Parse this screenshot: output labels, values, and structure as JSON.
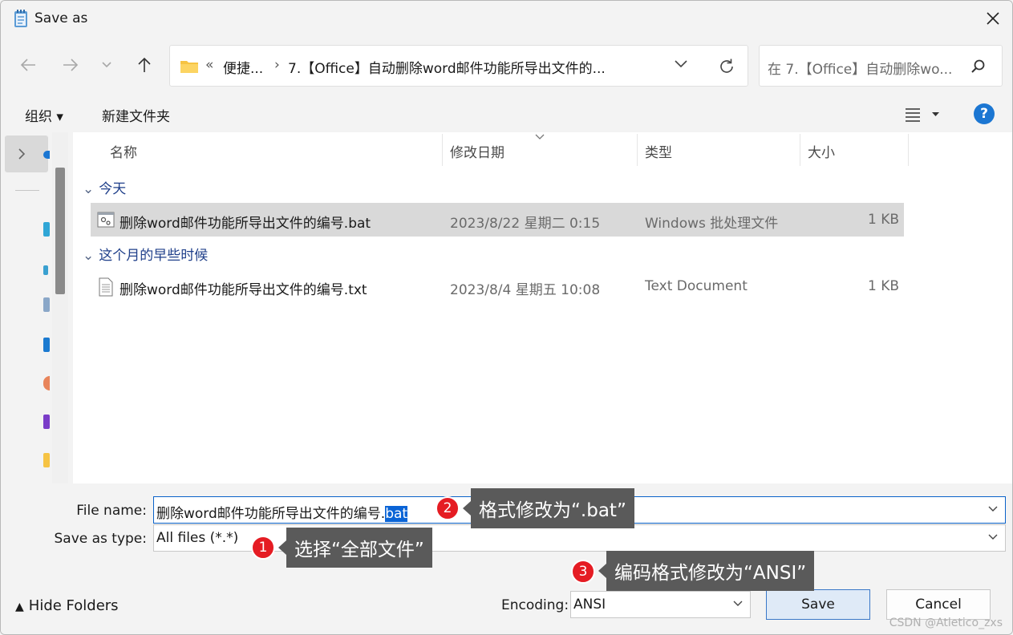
{
  "window": {
    "title": "Save as"
  },
  "address": {
    "overflow": "«",
    "crumb1": "便捷...",
    "separator": "›",
    "crumb2": "7.【Office】自动删除word邮件功能所导出文件的..."
  },
  "search": {
    "placeholder": "在 7.【Office】自动删除wo..."
  },
  "toolbar": {
    "organize": "组织 ▾",
    "new_folder": "新建文件夹"
  },
  "columns": {
    "name": "名称",
    "date": "修改日期",
    "type": "类型",
    "size": "大小"
  },
  "groups": [
    {
      "label": "今天",
      "files": [
        {
          "name": "删除word邮件功能所导出文件的编号.bat",
          "date": "2023/8/22 星期二 0:15",
          "type": "Windows 批处理文件",
          "size": "1 KB"
        }
      ]
    },
    {
      "label": "这个月的早些时候",
      "files": [
        {
          "name": "删除word邮件功能所导出文件的编号.txt",
          "date": "2023/8/4 星期五 10:08",
          "type": "Text Document",
          "size": "1 KB"
        }
      ]
    }
  ],
  "form": {
    "file_name_label": "File name:",
    "file_name_value": "删除word邮件功能所导出文件的编号.",
    "file_name_selected": "bat",
    "save_type_label": "Save as type:",
    "save_type_value": "All files  (*.*)",
    "encoding_label": "Encoding:",
    "encoding_value": "ANSI",
    "save_label": "Save",
    "cancel_label": "Cancel",
    "hide_folders_label": "Hide Folders"
  },
  "annotations": [
    {
      "number": "1",
      "text": "选择“全部文件”"
    },
    {
      "number": "2",
      "text": "格式修改为“.bat”"
    },
    {
      "number": "3",
      "text": "编码格式修改为“ANSI”"
    }
  ],
  "watermark": "CSDN @Atletico_zxs",
  "colors": {
    "accent": "#0a64d6",
    "help": "#1b76d2",
    "badge": "#e51c23",
    "callout": "#5a5a5a",
    "selected_row": "#d9d9d9"
  }
}
